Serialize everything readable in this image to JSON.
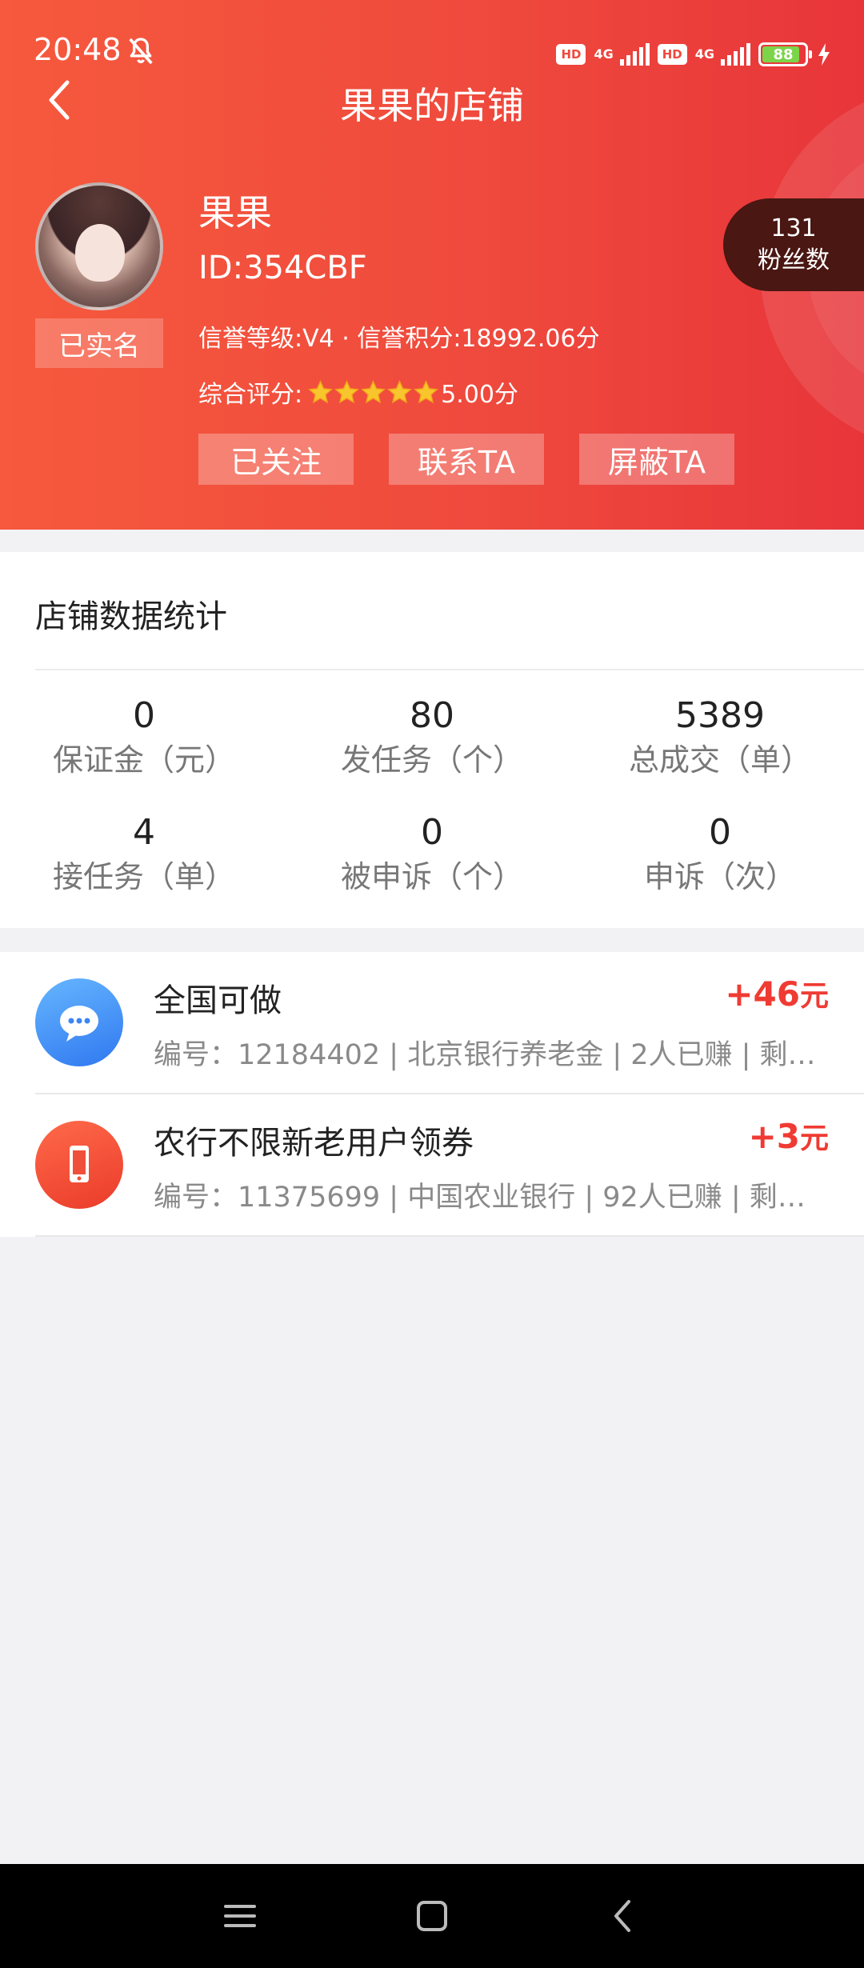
{
  "status_bar": {
    "time": "20:48",
    "hd1": "HD",
    "net1": "4G",
    "hd2": "HD",
    "net2": "4G",
    "battery": "88",
    "accent_bell": "bell-mute-icon"
  },
  "header": {
    "title": "果果的店铺",
    "background_start": "#f6593d",
    "background_end": "#e8353a"
  },
  "profile": {
    "name": "果果",
    "id_text": "ID:354CBF",
    "verified_label": "已实名",
    "credit_text": "信誉等级:V4 · 信誉积分:18992.06分",
    "rating_label": "综合评分:",
    "rating_value": 5.0,
    "rating_stars": 5,
    "rating_text": "5.00分",
    "fans_count": "131",
    "fans_label": "粉丝数"
  },
  "actions": {
    "follow": "已关注",
    "contact": "联系TA",
    "block": "屏蔽TA"
  },
  "stats": {
    "title": "店铺数据统计",
    "items": [
      {
        "value": "0",
        "label": "保证金（元）"
      },
      {
        "value": "80",
        "label": "发任务（个）"
      },
      {
        "value": "5389",
        "label": "总成交（单）"
      },
      {
        "value": "4",
        "label": "接任务（单）"
      },
      {
        "value": "0",
        "label": "被申诉（个）"
      },
      {
        "value": "0",
        "label": "申诉（次）"
      }
    ]
  },
  "tasks": [
    {
      "icon": "chat-bubble-icon",
      "title": "全国可做",
      "reward": "+46",
      "reward_unit": "元",
      "meta": "编号：12184402 | 北京银行养老金 | 2人已赚 | 剩余..."
    },
    {
      "icon": "phone-icon",
      "title": "农行不限新老用户领券",
      "reward": "+3",
      "reward_unit": "元",
      "meta": "编号：11375699 | 中国农业银行 | 92人已赚 | 剩余..."
    }
  ],
  "colors": {
    "accent_red": "#ef3b33",
    "fans_badge_bg": "#4a1713",
    "star_gold": "#f9c52c"
  }
}
